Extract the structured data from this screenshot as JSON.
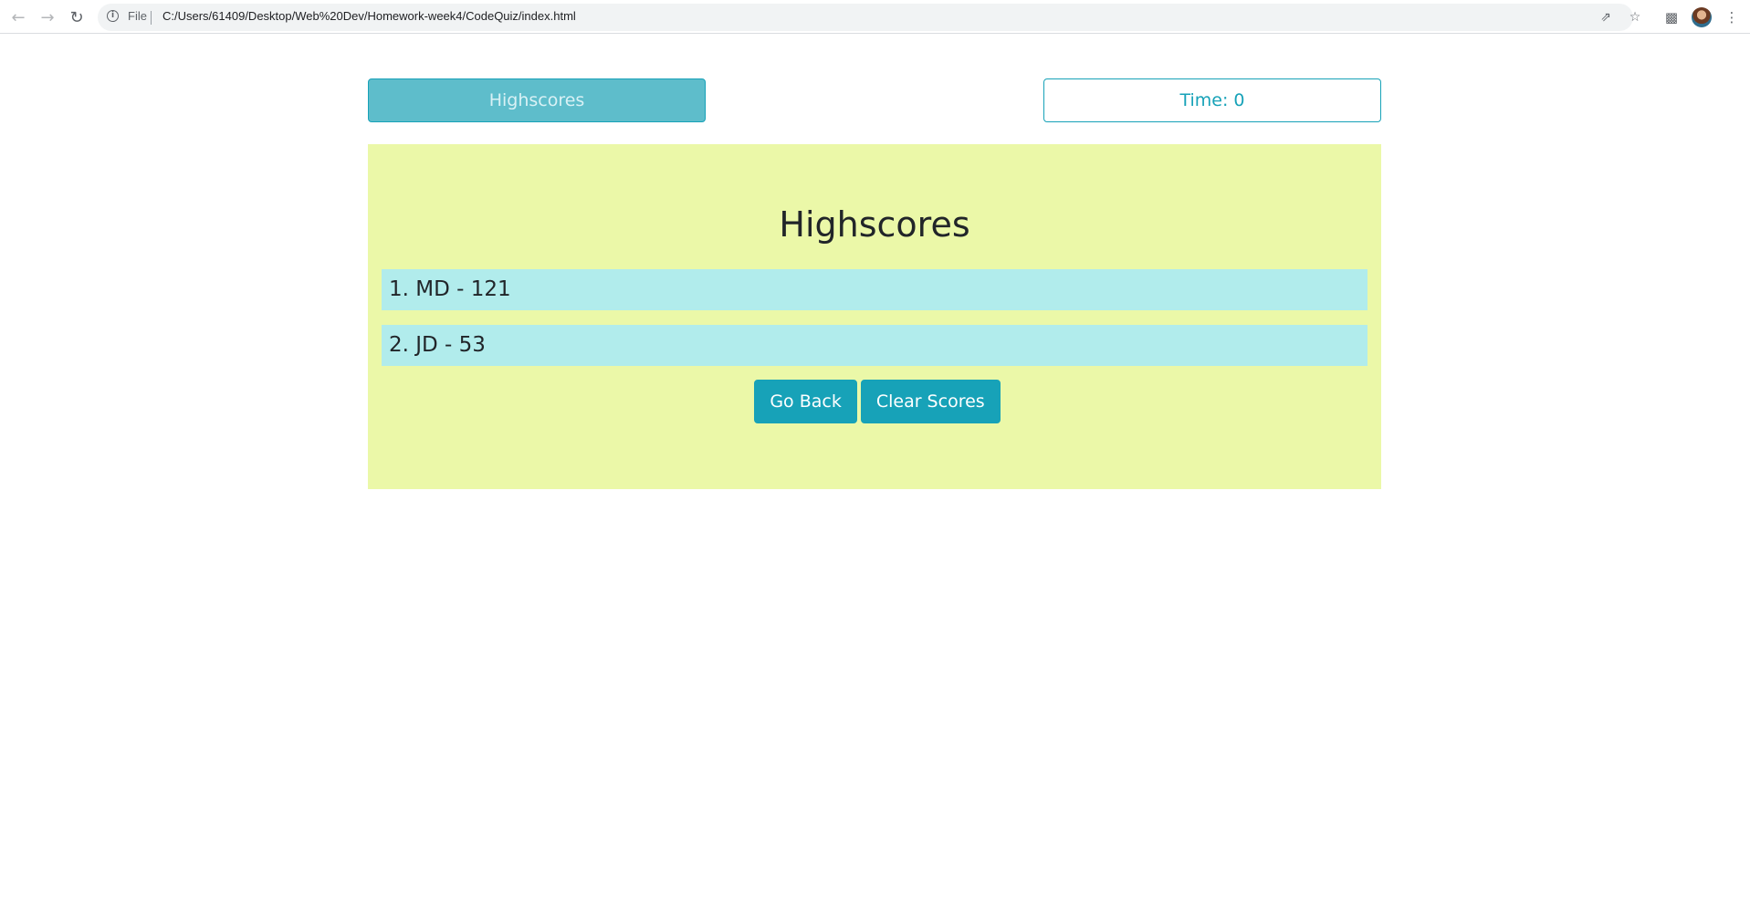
{
  "browser": {
    "back_icon": "back-arrow-icon",
    "forward_icon": "forward-arrow-icon",
    "reload_icon": "reload-icon",
    "site_info_icon": "info-icon",
    "scheme_label": "File",
    "url": "C:/Users/61409/Desktop/Web%20Dev/Homework-week4/CodeQuiz/index.html",
    "share_icon": "share-icon",
    "bookmark_icon": "star-icon",
    "extensions_icon": "puzzle-icon",
    "menu_icon": "kebab-menu-icon"
  },
  "header": {
    "highscores_label": "Highscores",
    "time_label": "Time: 0"
  },
  "card": {
    "title": "Highscores",
    "scores": [
      {
        "text": "1. MD - 121"
      },
      {
        "text": "2. JD - 53"
      }
    ],
    "go_back_label": "Go Back",
    "clear_label": "Clear Scores"
  },
  "colors": {
    "accent": "#17a2b8",
    "card_background": "#ebf8a8",
    "score_row_background": "#b1ecec"
  }
}
